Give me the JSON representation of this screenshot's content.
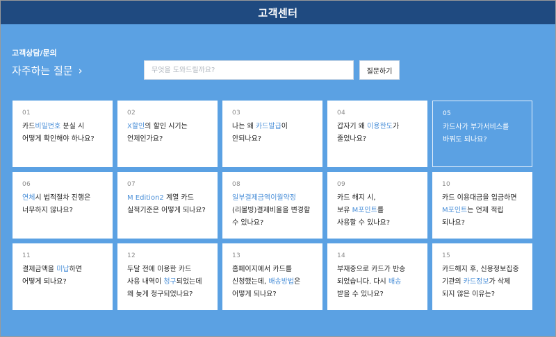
{
  "header": {
    "title": "고객센터"
  },
  "consult": {
    "section_label": "고객상담/문의",
    "faq_link_label": "자주하는 질문",
    "faq_chevron": "›",
    "search_placeholder": "무엇을 도와드릴까요?",
    "ask_button_label": "질문하기"
  },
  "colors": {
    "header_bg": "#1f4a80",
    "page_bg": "#5ba1e3",
    "highlight_text": "#4a8fd8"
  },
  "faq": [
    {
      "num": "01",
      "selected": false,
      "lines": [
        [
          {
            "t": "카드"
          },
          {
            "t": "비밀번호",
            "h": true
          },
          {
            "t": " 분실 시"
          }
        ],
        [
          {
            "t": "어떻게 확인해야 하나요?"
          }
        ]
      ]
    },
    {
      "num": "02",
      "selected": false,
      "lines": [
        [
          {
            "t": "X할인",
            "h": true
          },
          {
            "t": "의 할인 시기는"
          }
        ],
        [
          {
            "t": "언제인가요?"
          }
        ]
      ]
    },
    {
      "num": "03",
      "selected": false,
      "lines": [
        [
          {
            "t": "나는 왜 "
          },
          {
            "t": "카드발급",
            "h": true
          },
          {
            "t": "이"
          }
        ],
        [
          {
            "t": "안되나요?"
          }
        ]
      ]
    },
    {
      "num": "04",
      "selected": false,
      "lines": [
        [
          {
            "t": "갑자기 왜 "
          },
          {
            "t": "이용한도",
            "h": true
          },
          {
            "t": "가"
          }
        ],
        [
          {
            "t": "줄었나요?"
          }
        ]
      ]
    },
    {
      "num": "05",
      "selected": true,
      "lines": [
        [
          {
            "t": "카드사가 부가서비스를"
          }
        ],
        [
          {
            "t": "바꿔도 되나요?"
          }
        ]
      ]
    },
    {
      "num": "06",
      "selected": false,
      "lines": [
        [
          {
            "t": "연체",
            "h": true
          },
          {
            "t": "시 법적절차 진행은"
          }
        ],
        [
          {
            "t": "너무하지 않나요?"
          }
        ]
      ]
    },
    {
      "num": "07",
      "selected": false,
      "lines": [
        [
          {
            "t": "M Edition2",
            "h": true
          },
          {
            "t": " 계열 카드"
          }
        ],
        [
          {
            "t": "실적기준은 어떻게 되나요?"
          }
        ]
      ]
    },
    {
      "num": "08",
      "selected": false,
      "lines": [
        [
          {
            "t": "일부결제금액이월약정",
            "h": true
          }
        ],
        [
          {
            "t": "(리볼빙)결제비율을 변경할"
          }
        ],
        [
          {
            "t": "수 있나요?"
          }
        ]
      ]
    },
    {
      "num": "09",
      "selected": false,
      "lines": [
        [
          {
            "t": "카드 해지 시,"
          }
        ],
        [
          {
            "t": "보유 "
          },
          {
            "t": "M포인트",
            "h": true
          },
          {
            "t": "를"
          }
        ],
        [
          {
            "t": "사용할 수 있나요?"
          }
        ]
      ]
    },
    {
      "num": "10",
      "selected": false,
      "lines": [
        [
          {
            "t": "카드 이용대금을 입금하면"
          }
        ],
        [
          {
            "t": "M포인트",
            "h": true
          },
          {
            "t": "는 언제 적립"
          }
        ],
        [
          {
            "t": "되나요?"
          }
        ]
      ]
    },
    {
      "num": "11",
      "selected": false,
      "lines": [
        [
          {
            "t": "결제금액을 "
          },
          {
            "t": "미납",
            "h": true
          },
          {
            "t": "하면"
          }
        ],
        [
          {
            "t": "어떻게 되나요?"
          }
        ]
      ]
    },
    {
      "num": "12",
      "selected": false,
      "lines": [
        [
          {
            "t": "두달 전에 이용한 카드"
          }
        ],
        [
          {
            "t": "사용 내역이 "
          },
          {
            "t": "청구",
            "h": true
          },
          {
            "t": "되었는데"
          }
        ],
        [
          {
            "t": "왜 늦게 청구되었나요?"
          }
        ]
      ]
    },
    {
      "num": "13",
      "selected": false,
      "lines": [
        [
          {
            "t": "홈페이지에서 카드를"
          }
        ],
        [
          {
            "t": "신청했는데, "
          },
          {
            "t": "배송방법",
            "h": true
          },
          {
            "t": "은"
          }
        ],
        [
          {
            "t": "어떻게 되나요?"
          }
        ]
      ]
    },
    {
      "num": "14",
      "selected": false,
      "lines": [
        [
          {
            "t": "부재중으로 카드가 반송"
          }
        ],
        [
          {
            "t": "되었습니다. 다시 "
          },
          {
            "t": "배송",
            "h": true
          }
        ],
        [
          {
            "t": "받을 수 있나요?"
          }
        ]
      ]
    },
    {
      "num": "15",
      "selected": false,
      "lines": [
        [
          {
            "t": "카드해지 후, 신용정보집중"
          }
        ],
        [
          {
            "t": "기관의 "
          },
          {
            "t": "카드정보",
            "h": true
          },
          {
            "t": "가 삭제"
          }
        ],
        [
          {
            "t": "되지 않은 이유는?"
          }
        ]
      ]
    }
  ]
}
